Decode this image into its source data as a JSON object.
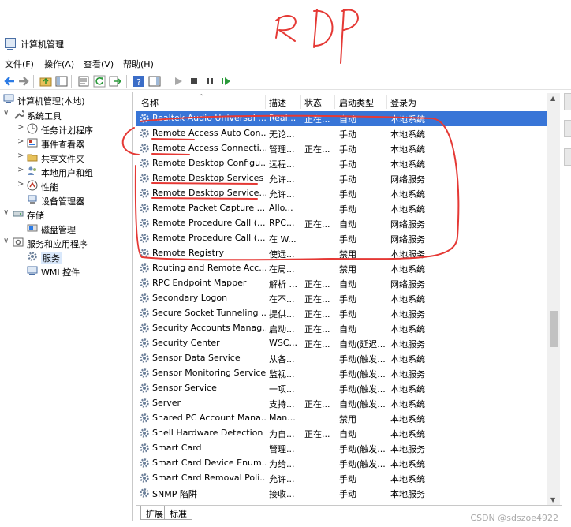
{
  "annotation": {
    "handwritten_text": "RDP",
    "ink_color": "#e53935"
  },
  "window": {
    "title": "计算机管理"
  },
  "menu": [
    "文件(F)",
    "操作(A)",
    "查看(V)",
    "帮助(H)"
  ],
  "tree": [
    {
      "label": "计算机管理(本地)",
      "arrow": "",
      "icon": "computer-management-icon"
    },
    {
      "label": "系统工具",
      "arrow": "∨",
      "icon": "tools-icon"
    },
    {
      "label": "任务计划程序",
      "arrow": ">",
      "icon": "clock-icon"
    },
    {
      "label": "事件查看器",
      "arrow": ">",
      "icon": "event-viewer-icon"
    },
    {
      "label": "共享文件夹",
      "arrow": ">",
      "icon": "folder-icon"
    },
    {
      "label": "本地用户和组",
      "arrow": ">",
      "icon": "users-icon"
    },
    {
      "label": "性能",
      "arrow": ">",
      "icon": "performance-icon"
    },
    {
      "label": "设备管理器",
      "arrow": "",
      "icon": "device-manager-icon"
    },
    {
      "label": "存储",
      "arrow": "∨",
      "icon": "storage-icon"
    },
    {
      "label": "磁盘管理",
      "arrow": "",
      "icon": "disk-icon"
    },
    {
      "label": "服务和应用程序",
      "arrow": "∨",
      "icon": "services-apps-icon"
    },
    {
      "label": "服务",
      "arrow": "",
      "icon": "gear-icon",
      "selected": true
    },
    {
      "label": "WMI 控件",
      "arrow": "",
      "icon": "wmi-icon"
    }
  ],
  "columns": {
    "name": "名称",
    "desc": "描述",
    "status": "状态",
    "startup": "启动类型",
    "logon": "登录为"
  },
  "services": [
    {
      "name": "Realtek Audio Universal ...",
      "desc": "Real...",
      "status": "正在...",
      "startup": "自动",
      "logon": "本地系统",
      "selected": true
    },
    {
      "name": "Remote Access Auto Con...",
      "desc": "无论...",
      "status": "",
      "startup": "手动",
      "logon": "本地系统"
    },
    {
      "name": "Remote Access Connecti...",
      "desc": "管理...",
      "status": "正在...",
      "startup": "手动",
      "logon": "本地系统"
    },
    {
      "name": "Remote Desktop Configu...",
      "desc": "远程...",
      "status": "",
      "startup": "手动",
      "logon": "本地系统"
    },
    {
      "name": "Remote Desktop Services",
      "desc": "允许...",
      "status": "",
      "startup": "手动",
      "logon": "网络服务"
    },
    {
      "name": "Remote Desktop Service...",
      "desc": "允许...",
      "status": "",
      "startup": "手动",
      "logon": "本地系统"
    },
    {
      "name": "Remote Packet Capture ...",
      "desc": "Allo...",
      "status": "",
      "startup": "手动",
      "logon": "本地系统"
    },
    {
      "name": "Remote Procedure Call (...",
      "desc": "RPC...",
      "status": "正在...",
      "startup": "自动",
      "logon": "网络服务"
    },
    {
      "name": "Remote Procedure Call (...",
      "desc": "在 W...",
      "status": "",
      "startup": "手动",
      "logon": "网络服务"
    },
    {
      "name": "Remote Registry",
      "desc": "使远...",
      "status": "",
      "startup": "禁用",
      "logon": "本地服务"
    },
    {
      "name": "Routing and Remote Acc...",
      "desc": "在局...",
      "status": "",
      "startup": "禁用",
      "logon": "本地系统"
    },
    {
      "name": "RPC Endpoint Mapper",
      "desc": "解析 ...",
      "status": "正在...",
      "startup": "自动",
      "logon": "网络服务"
    },
    {
      "name": "Secondary Logon",
      "desc": "在不...",
      "status": "正在...",
      "startup": "手动",
      "logon": "本地系统"
    },
    {
      "name": "Secure Socket Tunneling ...",
      "desc": "提供...",
      "status": "正在...",
      "startup": "手动",
      "logon": "本地服务"
    },
    {
      "name": "Security Accounts Manag...",
      "desc": "启动...",
      "status": "正在...",
      "startup": "自动",
      "logon": "本地系统"
    },
    {
      "name": "Security Center",
      "desc": "WSC...",
      "status": "正在...",
      "startup": "自动(延迟...",
      "logon": "本地服务"
    },
    {
      "name": "Sensor Data Service",
      "desc": "从各...",
      "status": "",
      "startup": "手动(触发...",
      "logon": "本地系统"
    },
    {
      "name": "Sensor Monitoring Service",
      "desc": "监视...",
      "status": "",
      "startup": "手动(触发...",
      "logon": "本地服务"
    },
    {
      "name": "Sensor Service",
      "desc": "一项...",
      "status": "",
      "startup": "手动(触发...",
      "logon": "本地系统"
    },
    {
      "name": "Server",
      "desc": "支持...",
      "status": "正在...",
      "startup": "自动(触发...",
      "logon": "本地系统"
    },
    {
      "name": "Shared PC Account Mana...",
      "desc": "Man...",
      "status": "",
      "startup": "禁用",
      "logon": "本地系统"
    },
    {
      "name": "Shell Hardware Detection",
      "desc": "为自...",
      "status": "正在...",
      "startup": "自动",
      "logon": "本地系统"
    },
    {
      "name": "Smart Card",
      "desc": "管理...",
      "status": "",
      "startup": "手动(触发...",
      "logon": "本地服务"
    },
    {
      "name": "Smart Card Device Enum...",
      "desc": "为给...",
      "status": "",
      "startup": "手动(触发...",
      "logon": "本地系统"
    },
    {
      "name": "Smart Card Removal Poli...",
      "desc": "允许...",
      "status": "",
      "startup": "手动",
      "logon": "本地系统"
    },
    {
      "name": "SNMP 陷阱",
      "desc": "接收...",
      "status": "",
      "startup": "手动",
      "logon": "本地服务"
    }
  ],
  "tabs": [
    {
      "label": "扩展",
      "active": false
    },
    {
      "label": "标准",
      "active": true
    }
  ],
  "watermark": "CSDN @sdszoe4922"
}
